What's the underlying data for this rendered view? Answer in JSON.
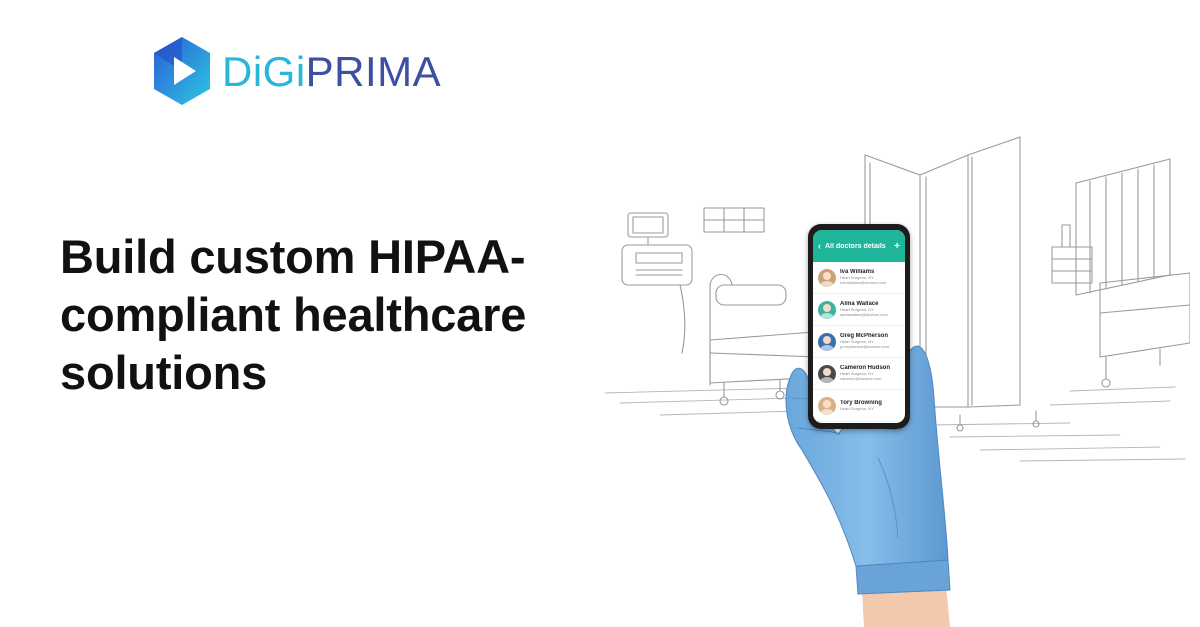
{
  "brand": {
    "logo_icon": "play-hexagon-icon",
    "name_part1": "DiGi",
    "name_part2": "PRIMA",
    "colors": {
      "digi": "#29b6d9",
      "prima": "#3d4fa0",
      "mark_dark": "#2a5bd7",
      "mark_light": "#2ec8e0"
    }
  },
  "headline": {
    "line1": "Build custom HIPAA-",
    "line2": "compliant healthcare",
    "line3": "solutions"
  },
  "phone": {
    "header_title": "All doctors details",
    "back_icon": "chevron-left-icon",
    "add_icon": "plus-icon",
    "accent": "#1fb59a",
    "doctors": [
      {
        "name": "Iva Williams",
        "role": "Heart Surgeon, NY",
        "email": "iva.williams@doctors.com",
        "avatar_color": "#c9a27a"
      },
      {
        "name": "Alma Wallace",
        "role": "Heart Surgeon, NY",
        "email": "almawallace@doctors.com",
        "avatar_color": "#3bb3a6"
      },
      {
        "name": "Greg McPherson",
        "role": "Heart Surgeon, NY",
        "email": "g.mcpherson@doctors.com",
        "avatar_color": "#3a6fb0"
      },
      {
        "name": "Cameron Hudson",
        "role": "Heart Surgeon, NY",
        "email": "cameron@doctors.com",
        "avatar_color": "#4a4a4a"
      },
      {
        "name": "Tory Browning",
        "role": "Heart Surgeon, NY",
        "email": "",
        "avatar_color": "#d8b08a"
      }
    ]
  },
  "illustration": {
    "subject": "hospital-room-sketch",
    "glove_color": "#7ab3e3"
  }
}
